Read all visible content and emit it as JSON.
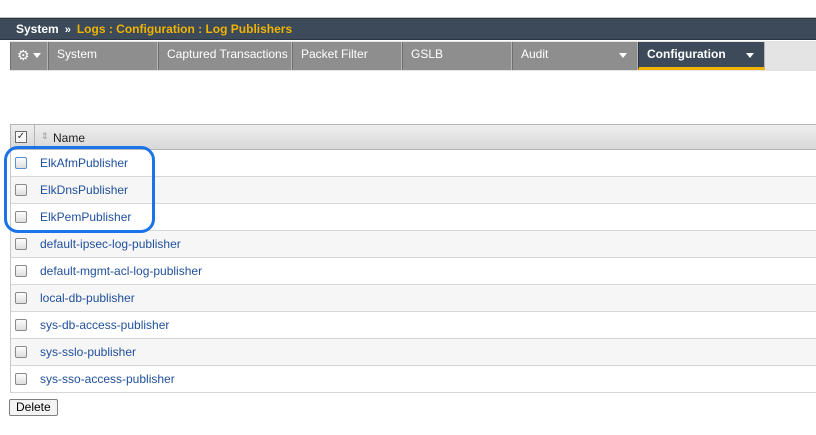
{
  "breadcrumb": {
    "system": "System",
    "separator": "»",
    "path": "Logs : Configuration : Log Publishers"
  },
  "tabs": [
    {
      "label": "System"
    },
    {
      "label": "Captured Transactions"
    },
    {
      "label": "Packet Filter"
    },
    {
      "label": "GSLB"
    },
    {
      "label": "Audit"
    },
    {
      "label": "Configuration"
    }
  ],
  "table": {
    "header_name": "Name",
    "rows": [
      "ElkAfmPublisher",
      "ElkDnsPublisher",
      "ElkPemPublisher",
      "default-ipsec-log-publisher",
      "default-mgmt-acl-log-publisher",
      "local-db-publisher",
      "sys-db-access-publisher",
      "sys-sslo-publisher",
      "sys-sso-access-publisher"
    ]
  },
  "actions": {
    "delete": "Delete"
  },
  "colors": {
    "accent": "#f0b400",
    "header_bg": "#3c4a5a",
    "highlight": "#1a73e8",
    "link": "#1f4f9c"
  },
  "icons": {
    "gear": "gear-icon",
    "caret": "chevron-down-icon",
    "sort": "sort-icon"
  }
}
